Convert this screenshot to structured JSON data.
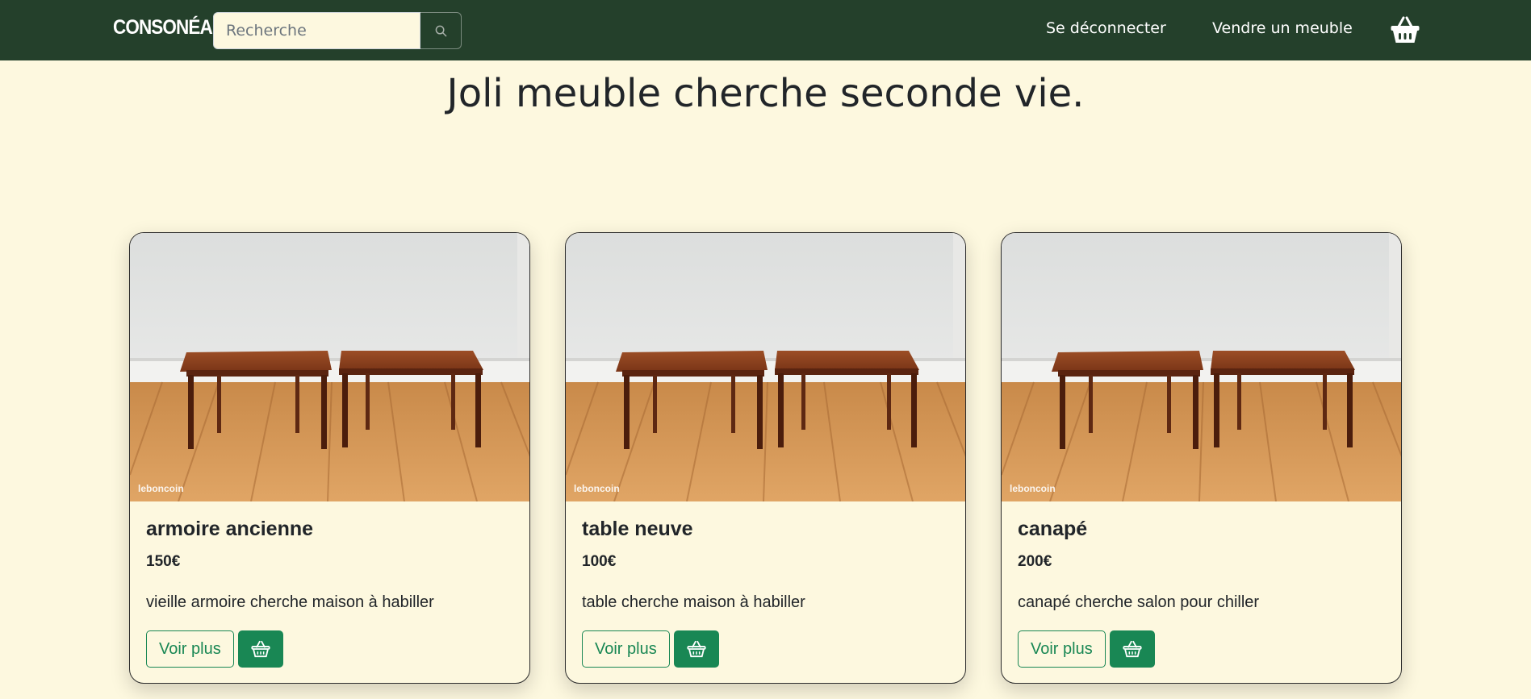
{
  "nav": {
    "brand": "CONSONÉA",
    "search_placeholder": "Recherche",
    "logout": "Se déconnecter",
    "sell": "Vendre un meuble",
    "cart_icon": "basket-icon",
    "search_icon": "search-icon"
  },
  "hero": {
    "title": "Joli meuble cherche seconde vie."
  },
  "image_watermark": "leboncoin",
  "products": [
    {
      "title": "armoire ancienne",
      "price": "150€",
      "description": "vieille armoire cherche maison à habiller",
      "more_label": "Voir plus"
    },
    {
      "title": "table neuve",
      "price": "100€",
      "description": "table cherche maison à habiller",
      "more_label": "Voir plus"
    },
    {
      "title": "canapé",
      "price": "200€",
      "description": "canapé cherche salon pour chiller",
      "more_label": "Voir plus"
    }
  ],
  "colors": {
    "navbar": "#24402b",
    "background": "#fdf8df",
    "accent": "#198754"
  }
}
